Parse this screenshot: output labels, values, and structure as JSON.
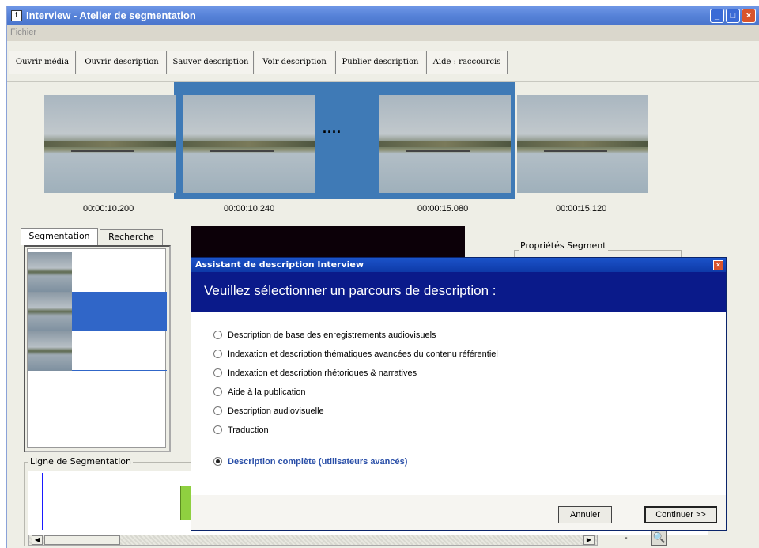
{
  "window": {
    "title": "Interview - Atelier de segmentation",
    "controls": {
      "minimize": "_",
      "maximize": "□",
      "close": "×"
    }
  },
  "menu": {
    "fichier": "Fichier"
  },
  "toolbar": {
    "ouvrir_media": "Ouvrir média",
    "ouvrir_description": "Ouvrir description",
    "sauver_description": "Sauver description",
    "voir_description": "Voir description",
    "publier_description": "Publier description",
    "aide_raccourcis": "Aide : raccourcis"
  },
  "thumbnails": {
    "t1": "00:00:10.200",
    "t2": "00:00:10.240",
    "separator": "....",
    "t3": "00:00:15.080",
    "t4": "00:00:15.120"
  },
  "tabs": {
    "segmentation": "Segmentation",
    "recherche": "Recherche"
  },
  "ligne": {
    "label": "Ligne de Segmentation",
    "dash": "-"
  },
  "props": {
    "label": "Propriétés Segment"
  },
  "dialog": {
    "title": "Assistant de description Interview",
    "close": "×",
    "heading": "Veuillez sélectionner un parcours de description :",
    "options": [
      "Description de base des enregistrements audiovisuels",
      "Indexation et description thématiques avancées du contenu référentiel",
      "Indexation et description rhétoriques & narratives",
      "Aide à la publication",
      "Description audiovisuelle",
      "Traduction",
      "Description complète (utilisateurs avancés)"
    ],
    "selected_index": 6,
    "annuler": "Annuler",
    "continuer": "Continuer >>"
  },
  "icons": {
    "app": "app-window-icon",
    "zoom": "magnifier-icon",
    "scroll_left": "arrow-left-icon",
    "scroll_right": "arrow-right-icon"
  },
  "colors": {
    "titlebar": "#5682d8",
    "dialog_header": "#0a1a8a",
    "selection": "#3066c8",
    "thumb_selection_band": "#3f7ab6",
    "selected_option_text": "#2a4fa8"
  }
}
